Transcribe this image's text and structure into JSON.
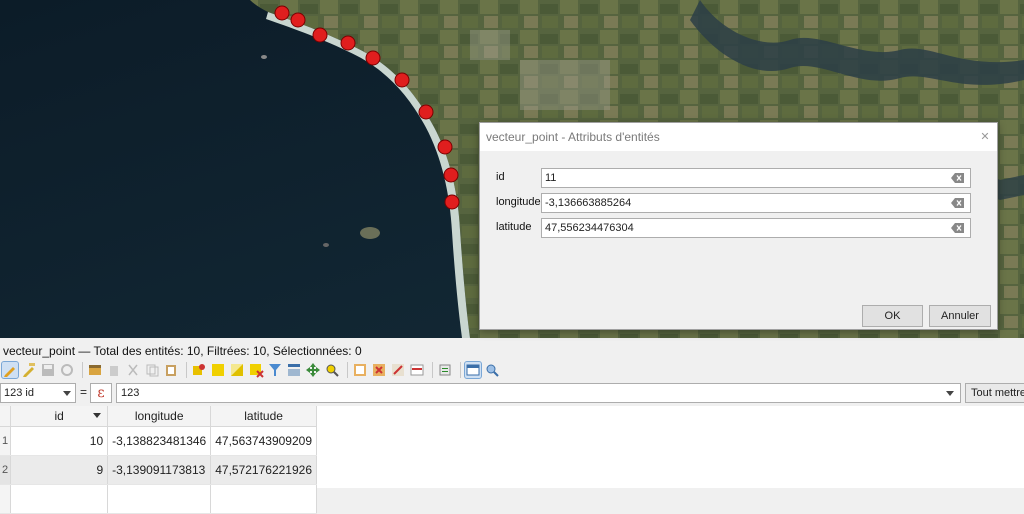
{
  "dialog": {
    "title": "vecteur_point - Attributs d'entités",
    "close_icon": "close-icon",
    "fields": [
      {
        "label": "id",
        "value": "11"
      },
      {
        "label": "longitude",
        "value": "-3,136663885264"
      },
      {
        "label": "latitude",
        "value": "47,556234476304"
      }
    ],
    "ok_label": "OK",
    "cancel_label": "Annuler"
  },
  "table_panel": {
    "title": "vecteur_point — Total des entités: 10, Filtrées: 10, Sélectionnées: 0",
    "filter": {
      "field_selected": "123 id",
      "operator": "=",
      "expression_icon": "epsilon-icon",
      "value": "123",
      "update_button": "Tout mettre à jour"
    },
    "columns": [
      "id",
      "longitude",
      "latitude"
    ],
    "rows": [
      {
        "row_header": "1",
        "id": "10",
        "longitude": "-3,138823481346",
        "latitude": "47,563743909209"
      },
      {
        "row_header": "2",
        "id": "9",
        "longitude": "-3,139091173813",
        "latitude": "47,572176221926"
      }
    ]
  },
  "map": {
    "point_color": "#e01e1e",
    "point_outline": "#ffffff",
    "point_count": 10
  },
  "colors": {
    "sea": "#0f2230",
    "land": "#4a5a3a",
    "beach": "#c9d6d0"
  }
}
